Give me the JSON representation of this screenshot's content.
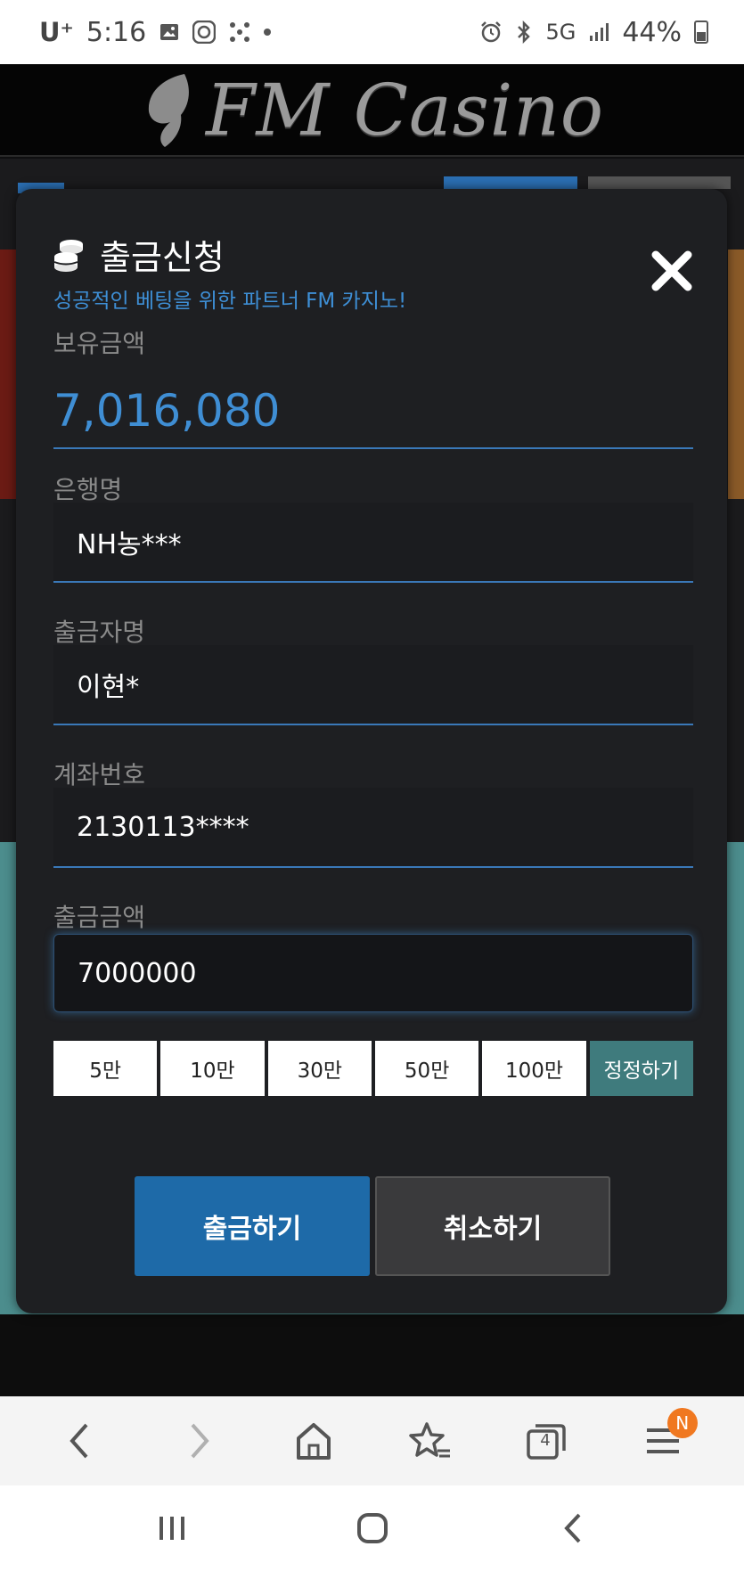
{
  "status_bar": {
    "carrier": "U⁺",
    "time": "5:16",
    "network": "5G",
    "battery": "44%"
  },
  "site": {
    "logo_text": "FM Casino"
  },
  "modal": {
    "title": "출금신청",
    "subtitle": "성공적인 베팅을 위한 파트너 FM 카지노!",
    "balance_label": "보유금액",
    "balance_value": "7,016,080",
    "bank_label": "은행명",
    "bank_value": "NH농***",
    "holder_label": "출금자명",
    "holder_value": "이현*",
    "account_label": "계좌번호",
    "account_value": "2130113****",
    "amount_label": "출금금액",
    "amount_value": "7000000",
    "quick_amounts": [
      "5만",
      "10만",
      "30만",
      "50만",
      "100만"
    ],
    "reset_label": "정정하기",
    "submit_label": "출금하기",
    "cancel_label": "취소하기"
  },
  "browser_bar": {
    "tabs_count": "4",
    "menu_badge": "N"
  },
  "colors": {
    "accent_blue": "#3f8ed4",
    "submit_blue": "#1e6aa8",
    "reset_teal": "#3f7b7d",
    "badge_orange": "#f07820"
  }
}
